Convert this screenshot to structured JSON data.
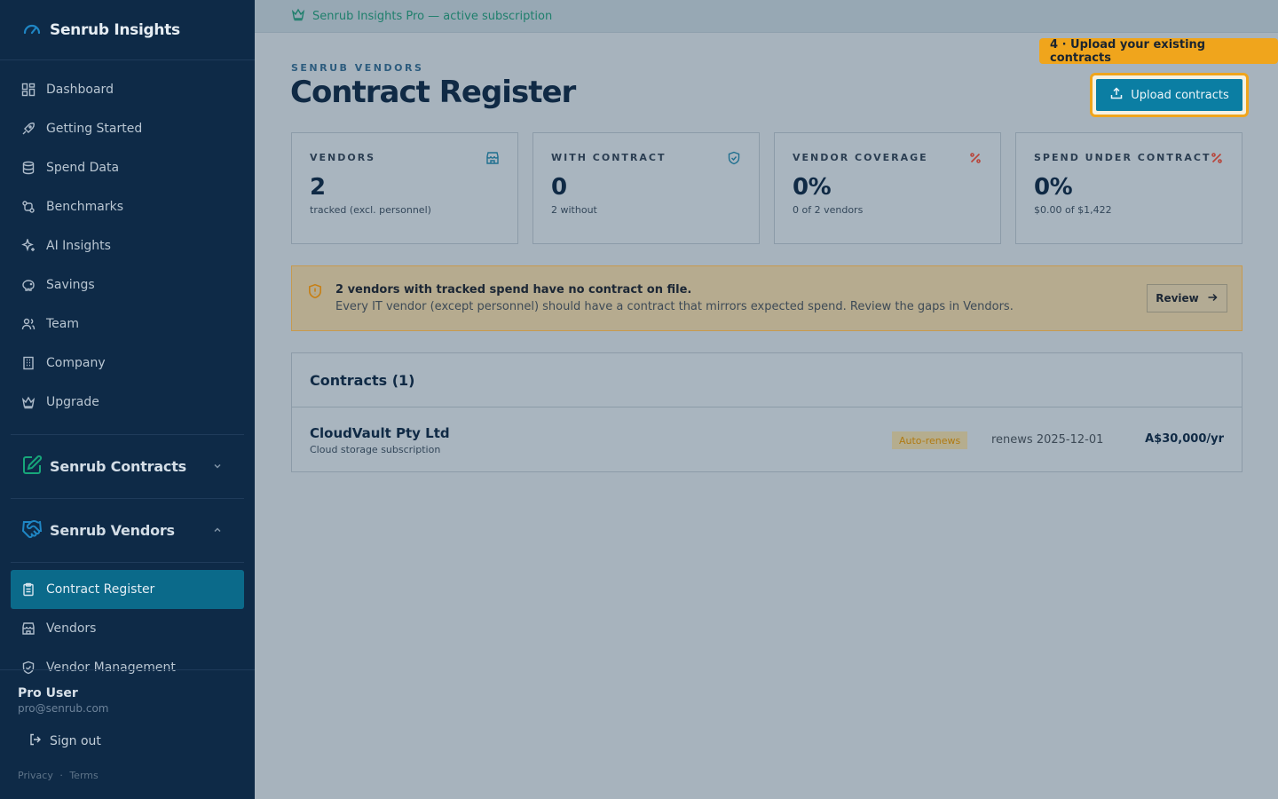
{
  "brand": {
    "title": "Senrub Insights"
  },
  "nav": [
    {
      "label": "Dashboard",
      "icon": "dashboard-icon"
    },
    {
      "label": "Getting Started",
      "icon": "rocket-icon"
    },
    {
      "label": "Spend Data",
      "icon": "database-icon"
    },
    {
      "label": "Benchmarks",
      "icon": "benchmarks-icon"
    },
    {
      "label": "AI Insights",
      "icon": "sparkles-icon"
    },
    {
      "label": "Savings",
      "icon": "piggy-bank-icon"
    },
    {
      "label": "Team",
      "icon": "users-icon"
    },
    {
      "label": "Company",
      "icon": "building-icon"
    },
    {
      "label": "Upgrade",
      "icon": "crown-icon"
    }
  ],
  "sections": {
    "contracts": {
      "title": "Senrub Contracts"
    },
    "vendors": {
      "title": "Senrub Vendors"
    }
  },
  "vendor_nav": [
    {
      "label": "Contract Register",
      "icon": "clipboard-icon",
      "active": true
    },
    {
      "label": "Vendors",
      "icon": "store-icon"
    },
    {
      "label": "Vendor Management",
      "icon": "shield-check-icon"
    }
  ],
  "user": {
    "name": "Pro User",
    "email": "pro@senrub.com",
    "signout": "Sign out",
    "privacy": "Privacy",
    "sep": "·",
    "terms": "Terms"
  },
  "banner": {
    "text": "Senrub Insights Pro — active subscription"
  },
  "page": {
    "eyebrow": "SENRUB VENDORS",
    "title": "Contract Register"
  },
  "tip": {
    "text": "4 · Upload your existing contracts"
  },
  "upload": {
    "label": "Upload contracts"
  },
  "stats": [
    {
      "label": "VENDORS",
      "value": "2",
      "sub": "tracked (excl. personnel)",
      "icon": "store-icon",
      "icon_color": "#1f6f8f"
    },
    {
      "label": "WITH CONTRACT",
      "value": "0",
      "sub": "2 without",
      "icon": "shield-check-icon",
      "icon_color": "#1f6f8f"
    },
    {
      "label": "VENDOR COVERAGE",
      "value": "0%",
      "sub": "0 of 2 vendors",
      "icon": "percent-icon",
      "icon_color": "#b8443a"
    },
    {
      "label": "SPEND UNDER CONTRACT",
      "value": "0%",
      "sub": "$0.00 of $1,422",
      "icon": "percent-icon",
      "icon_color": "#b8443a"
    }
  ],
  "alert": {
    "title": "2 vendors with tracked spend have no contract on file.",
    "body": "Every IT vendor (except personnel) should have a contract that mirrors expected spend. Review the gaps in Vendors.",
    "button": "Review"
  },
  "contracts": {
    "heading": "Contracts (1)",
    "rows": [
      {
        "name": "CloudVault Pty Ltd",
        "desc": "Cloud storage subscription",
        "badge": "Auto-renews",
        "renews": "renews 2025-12-01",
        "amount": "A$30,000/yr"
      }
    ]
  }
}
